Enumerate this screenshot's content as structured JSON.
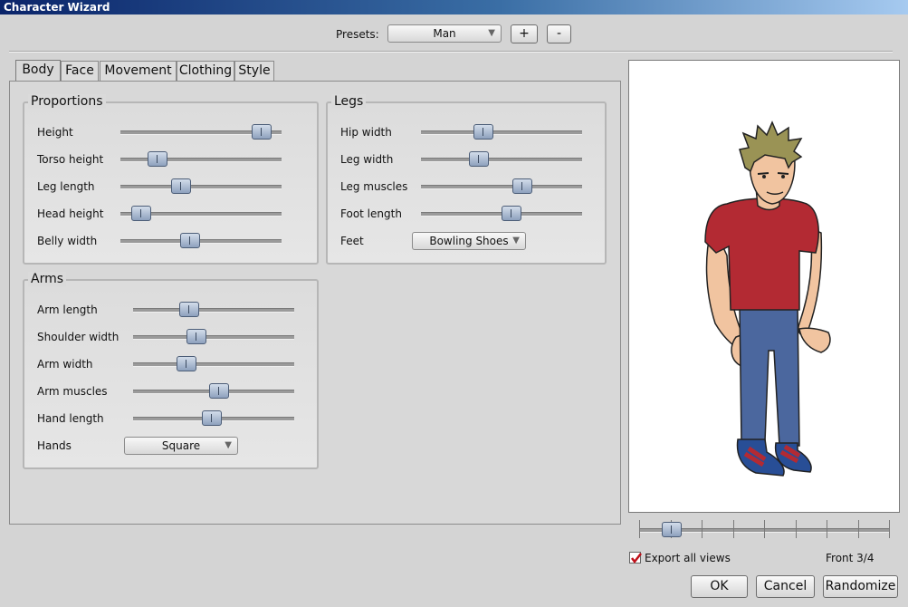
{
  "window": {
    "title": "Character Wizard"
  },
  "presets": {
    "label": "Presets:",
    "value": "Man",
    "add_label": "+",
    "remove_label": "-"
  },
  "tabs": [
    {
      "label": "Body",
      "active": true
    },
    {
      "label": "Face"
    },
    {
      "label": "Movement"
    },
    {
      "label": "Clothing"
    },
    {
      "label": "Style"
    }
  ],
  "proportions": {
    "title": "Proportions",
    "sliders": [
      {
        "label": "Height",
        "value": 0.93
      },
      {
        "label": "Torso height",
        "value": 0.19
      },
      {
        "label": "Leg length",
        "value": 0.36
      },
      {
        "label": "Head height",
        "value": 0.08
      },
      {
        "label": "Belly width",
        "value": 0.42
      }
    ]
  },
  "legs": {
    "title": "Legs",
    "sliders": [
      {
        "label": "Hip width",
        "value": 0.37
      },
      {
        "label": "Leg width",
        "value": 0.34
      },
      {
        "label": "Leg muscles",
        "value": 0.65
      },
      {
        "label": "Foot length",
        "value": 0.57
      }
    ],
    "feet_label": "Feet",
    "feet_value": "Bowling Shoes"
  },
  "arms": {
    "title": "Arms",
    "sliders": [
      {
        "label": "Arm length",
        "value": 0.33
      },
      {
        "label": "Shoulder width",
        "value": 0.38
      },
      {
        "label": "Arm width",
        "value": 0.31
      },
      {
        "label": "Arm muscles",
        "value": 0.54
      },
      {
        "label": "Hand length",
        "value": 0.49
      }
    ],
    "hands_label": "Hands",
    "hands_value": "Square"
  },
  "view": {
    "slider_value": 0.1,
    "tick_count": 9,
    "export_label": "Export all views",
    "export_checked": true,
    "view_label": "Front 3/4"
  },
  "buttons": {
    "ok": "OK",
    "cancel": "Cancel",
    "randomize": "Randomize"
  },
  "colors": {
    "shirt": "#b32a33",
    "jeans": "#4b679e",
    "skin": "#f1c4a0",
    "hair": "#9a9355",
    "shoes": "#284e96",
    "accent": "#0a246a"
  }
}
